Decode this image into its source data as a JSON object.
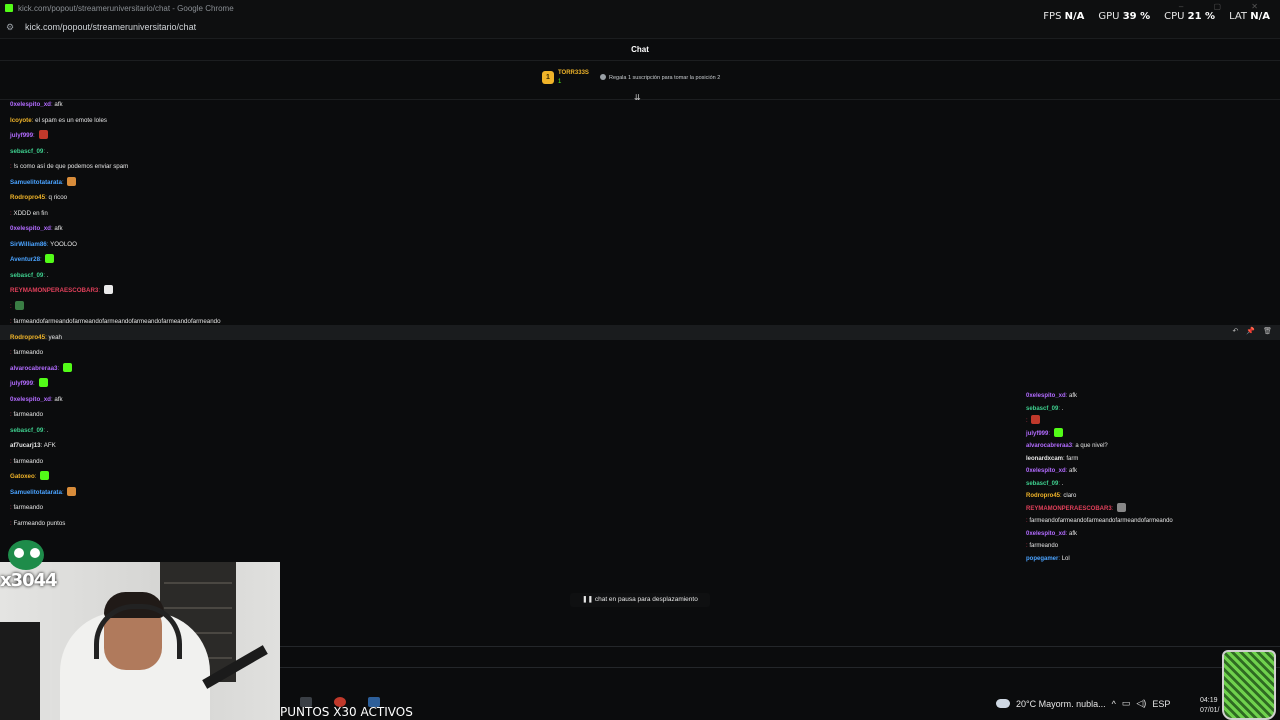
{
  "window": {
    "title": "kick.com/popout/streameruniversitario/chat - Google Chrome",
    "url": "kick.com/popout/streameruniversitario/chat"
  },
  "stats": {
    "fps_label": "FPS",
    "fps_value": "N/A",
    "gpu_label": "GPU",
    "gpu_value": "39 %",
    "cpu_label": "CPU",
    "cpu_value": "21 %",
    "lat_label": "LAT",
    "lat_value": "N/A"
  },
  "chat": {
    "header": "Chat",
    "pinned": {
      "rank": "1",
      "user": "TORR333S",
      "count": "1",
      "message": "Regala 1 suscripción para tomar la posición 2"
    },
    "messages": [
      {
        "user": "0xelespito_xd",
        "color": "#b26bff",
        "text": "afk"
      },
      {
        "user": "lcoyote",
        "color": "#f0b429",
        "text": "el spam es un emote loles"
      },
      {
        "user": "julyf999",
        "color": "#b26bff",
        "text": "",
        "emote": "#c0392b"
      },
      {
        "user": "sebascf_09",
        "color": "#3ecf8e",
        "text": "."
      },
      {
        "user": "",
        "color": "#e0405a",
        "text": "!s como así de que podemos enviar spam"
      },
      {
        "user": "Samuelitotatarata",
        "color": "#4aa3ff",
        "text": "",
        "emote": "#d88c3a"
      },
      {
        "user": "Rodropro45",
        "color": "#f0b429",
        "text": "q ricoo"
      },
      {
        "user": "",
        "color": "#e0405a",
        "text": "XDDD en fin"
      },
      {
        "user": "0xelespito_xd",
        "color": "#b26bff",
        "text": "afk"
      },
      {
        "user": "SirWilliam86",
        "color": "#4aa3ff",
        "text": "YOOLOO"
      },
      {
        "user": "Aventur28",
        "color": "#4aa3ff",
        "text": "",
        "emote": "#53fc18"
      },
      {
        "user": "sebascf_09",
        "color": "#3ecf8e",
        "text": "."
      },
      {
        "user": "REYMAMONPERAESCOBAR3",
        "color": "#e0405a",
        "text": "",
        "emote": "#eaeaea"
      },
      {
        "user": "",
        "color": "#e0405a",
        "text": "",
        "emote": "#3a7d44"
      },
      {
        "user": "",
        "color": "#e0405a",
        "text": "farmeandofarmeandofarmeandofarmeandofarmeandofarmeandofarmeando"
      },
      {
        "user": "Rodropro45",
        "color": "#f0b429",
        "text": "yeah"
      },
      {
        "user": "",
        "color": "#e0405a",
        "text": "farmeando"
      },
      {
        "user": "alvarocabreraa3",
        "color": "#b26bff",
        "text": "",
        "emote": "#53fc18"
      },
      {
        "user": "julyf999",
        "color": "#b26bff",
        "text": "",
        "emote": "#53fc18"
      },
      {
        "user": "0xelespito_xd",
        "color": "#b26bff",
        "text": "afk"
      },
      {
        "user": "",
        "color": "#e0405a",
        "text": "farmeando"
      },
      {
        "user": "sebascf_09",
        "color": "#3ecf8e",
        "text": "."
      },
      {
        "user": "af7ucarj13",
        "color": "#e6e6e6",
        "text": "AFK"
      },
      {
        "user": "",
        "color": "#e0405a",
        "text": "farmeando"
      },
      {
        "user": "Gatoxeo",
        "color": "#f0b429",
        "text": "",
        "emote": "#53fc18"
      },
      {
        "user": "Samuelitotatarata",
        "color": "#4aa3ff",
        "text": "",
        "emote": "#d88c3a"
      },
      {
        "user": "",
        "color": "#e0405a",
        "text": "farmeando"
      },
      {
        "user": "",
        "color": "#e0405a",
        "text": "Farmeando puntos"
      }
    ],
    "paused_label": "chat en pausa para desplazamiento"
  },
  "overlay_chat": {
    "messages": [
      {
        "user": "0xelespito_xd",
        "color": "#b26bff",
        "text": "afk"
      },
      {
        "user": "sebascf_09",
        "color": "#3ecf8e",
        "text": "."
      },
      {
        "user": "",
        "color": "#e0405a",
        "text": "",
        "emote": "#c0392b"
      },
      {
        "user": "julyf999",
        "color": "#b26bff",
        "text": "",
        "emote": "#53fc18"
      },
      {
        "user": "alvarocabreraa3",
        "color": "#b26bff",
        "text": "a que nivel?"
      },
      {
        "user": "leonardxcam",
        "color": "#e6e6e6",
        "text": "farm"
      },
      {
        "user": "0xelespito_xd",
        "color": "#b26bff",
        "text": "afk"
      },
      {
        "user": "sebascf_09",
        "color": "#3ecf8e",
        "text": "."
      },
      {
        "user": "Rodropro45",
        "color": "#f0b429",
        "text": "claro"
      },
      {
        "user": "REYMAMONPERAESCOBAR3",
        "color": "#e0405a",
        "text": "",
        "emote": "#888888"
      },
      {
        "user": "",
        "color": "#e0405a",
        "text": "farmeandofarmeandofarmeandofarmeandofarmeando"
      },
      {
        "user": "0xelespito_xd",
        "color": "#b26bff",
        "text": "afk"
      },
      {
        "user": "",
        "color": "#e0405a",
        "text": "farmeando"
      },
      {
        "user": "popegamer",
        "color": "#4aa3ff",
        "text": "Lol"
      }
    ]
  },
  "stream": {
    "logo_text": "x3044",
    "points_text": "PUNTOS X30 ACTIVOS"
  },
  "taskbar": {
    "weather": "20°C  Mayorm. nubla...",
    "language": "ESP",
    "time": "04:19",
    "date": "07/01/"
  }
}
